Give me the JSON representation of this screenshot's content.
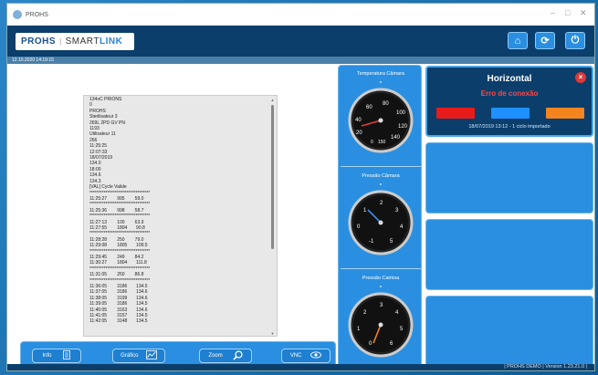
{
  "window": {
    "title": "PROHS",
    "minimize": "–",
    "maximize": "□",
    "close": "✕"
  },
  "header": {
    "logo_prohs": "PROHS",
    "logo_smart": "SMART",
    "logo_link": "LINK",
    "buttons": [
      {
        "name": "home-button",
        "icon": "home-icon",
        "glyph": "⌂"
      },
      {
        "name": "refresh-button",
        "icon": "refresh-icon",
        "glyph": "⟳"
      },
      {
        "name": "power-button",
        "icon": "power-icon",
        "glyph": "⏻"
      }
    ]
  },
  "datetime": "12.10.2020  14:19:15",
  "log": {
    "lines": [
      "134oC PRIONS",
      "0",
      "PROHS",
      "Sterilisateur 3",
      "269L 2PD GV PN",
      "1193",
      "Utilisateur 11",
      "266",
      "11:25:25",
      "12:07:33",
      "18/07/2019",
      "134.0",
      "18:00",
      "134.6",
      "134.3",
      "[VAL] Cycle Valide",
      "**********************************",
      "11:25:27        995        59.0",
      "**********************************",
      "11:25:36        998        58.7",
      "**********************************",
      "11:27:13        100        63.9",
      "11:27:55        1804       90.8",
      "**********************************",
      "11:28:28        250        79.0",
      "11:29:08        1805       109.5",
      "**********************************",
      "11:29:45        249        84.2",
      "11:30:27        1804       111.8",
      "**********************************",
      "11:31:05        250        86.8",
      "**********************************",
      "11:36:05        3186       134.5",
      "11:37:05        3186       134.6",
      "11:38:05        3199       134.6",
      "11:39:05        3186       134.5",
      "11:40:05        3163       134.6",
      "11:41:05        3157       134.5",
      "11:42:05        3148       134.5"
    ]
  },
  "toolbar": {
    "info_label": "Info",
    "grafico_label": "Gráfico",
    "zoom_label": "Zoom",
    "vnc_label": "VNC"
  },
  "gauges": [
    {
      "title": "Temperatura Câmara",
      "value": "-",
      "ticks": [
        "20",
        "40",
        "60",
        "80",
        "100",
        "120",
        "140",
        "0",
        "150"
      ]
    },
    {
      "title": "Pressão Câmara",
      "value": "-",
      "ticks": [
        "-1",
        "0",
        "1",
        "2",
        "3",
        "4",
        "5"
      ]
    },
    {
      "title": "Pressão Camisa",
      "value": "-",
      "ticks": [
        "0",
        "1",
        "2",
        "3",
        "4",
        "5",
        "6"
      ]
    }
  ],
  "machine": {
    "title": "Horizontal",
    "error": "Erro de conexão",
    "status_colors": [
      "#e81b1b",
      "#1e90ff",
      "#f5841f"
    ],
    "last_cycle": "18/07/2019 13:12 - 1 ciclo importado"
  },
  "footer": "|  PROHS DEMO  |  Version 1.23.21.0  |"
}
